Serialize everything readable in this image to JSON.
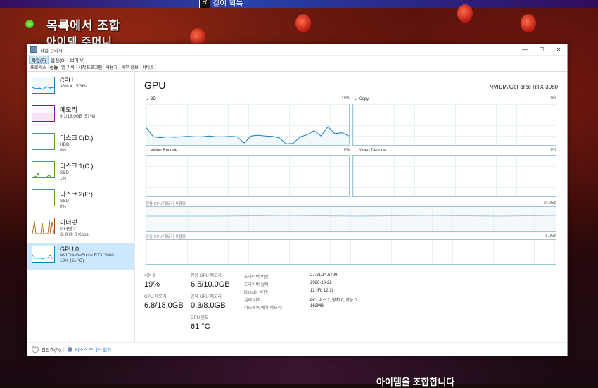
{
  "game": {
    "top_key": "R",
    "top_key_label": "길이 획득",
    "title": "목록에서 조합",
    "subtitle": "아이템 주머니",
    "bottom_text": "아이템을 조합합니다"
  },
  "window": {
    "title": "작업 관리자",
    "controls": [
      "—",
      "☐",
      "✕"
    ]
  },
  "menu": [
    "파일(F)",
    "옵션(O)",
    "보기(V)"
  ],
  "tabs": [
    "프로세스",
    "성능",
    "앱 기록",
    "시작프로그램",
    "사용자",
    "세부 정보",
    "서비스"
  ],
  "sidebar": [
    {
      "name": "CPU",
      "detail1": "38% 4.15GHz",
      "detail2": "",
      "detail3": "",
      "color": "#117dbb"
    },
    {
      "name": "메모리",
      "detail1": "9.1/16.0GB (57%)",
      "detail2": "",
      "detail3": "",
      "color": "#8b12ae"
    },
    {
      "name": "디스크 0(D:)",
      "detail1": "HDD",
      "detail2": "0%",
      "detail3": "",
      "color": "#4da60c"
    },
    {
      "name": "디스크 1(C:)",
      "detail1": "SSD",
      "detail2": "1%",
      "detail3": "",
      "color": "#4da60c"
    },
    {
      "name": "디스크 2(E:)",
      "detail1": "SSD",
      "detail2": "0%",
      "detail3": "",
      "color": "#4da60c"
    },
    {
      "name": "이더넷",
      "detail1": "이더넷 2",
      "detail2": "S: 0 R: 0 Kbps",
      "detail3": "",
      "color": "#a74f01"
    },
    {
      "name": "GPU 0",
      "detail1": "NVIDIA GeForce RTX 3080",
      "detail2": "19% (61 °C)",
      "detail3": "",
      "color": "#117dbb"
    }
  ],
  "main": {
    "title": "GPU",
    "model": "NVIDIA GeForce RTX 3080",
    "panels": [
      {
        "label": "3D",
        "pct": "19%"
      },
      {
        "label": "Copy",
        "pct": "0%"
      },
      {
        "label": "Video Encode",
        "pct": "0%"
      },
      {
        "label": "Video Decode",
        "pct": "0%"
      }
    ],
    "dedicated_mem_label": "전용 GPU 메모리 사용량",
    "dedicated_mem_max": "10.0GB",
    "shared_mem_label": "공유 GPU 메모리 사용량",
    "shared_mem_max": "8.0GB",
    "stats": {
      "usage_label": "사용률",
      "usage_value": "19%",
      "dedicated_label": "전용 GPU 메모리",
      "dedicated_value": "6.5/10.0GB",
      "gpu_mem_label": "GPU 메모리",
      "gpu_mem_value": "6.8/18.0GB",
      "shared_label": "공유 GPU 메모리",
      "shared_value": "0.3/8.0GB",
      "temp_label": "GPU 온도",
      "temp_value": "61 °C"
    },
    "info": [
      {
        "label": "드라이버 버전:",
        "value": "27.21.14.5709"
      },
      {
        "label": "드라이버 날짜:",
        "value": "2020-10-22"
      },
      {
        "label": "DirectX 버전:",
        "value": "12 (FL 12.1)"
      },
      {
        "label": "실제 위치:",
        "value": "PCI 버스 7, 장치 0, 기능 0"
      },
      {
        "label": "하드웨어 예약 메모리:",
        "value": "163MB"
      }
    ],
    "graph_3d_series": [
      0.42,
      0.2,
      0.18,
      0.2,
      0.19,
      0.2,
      0.21,
      0.2,
      0.2,
      0.22,
      0.2,
      0.2,
      0.21,
      0.2,
      0.05,
      0.22,
      0.24,
      0.22,
      0.21,
      0.18,
      0.03,
      0.04,
      0.2,
      0.25,
      0.35,
      0.22,
      0.45,
      0.28,
      0.3,
      0.22
    ],
    "dedicated_mem_fraction": 0.65,
    "shared_mem_fraction": 0.04
  },
  "footer": {
    "less_label": "간단히(D)",
    "link_label": "리소스 모니터 열기"
  }
}
